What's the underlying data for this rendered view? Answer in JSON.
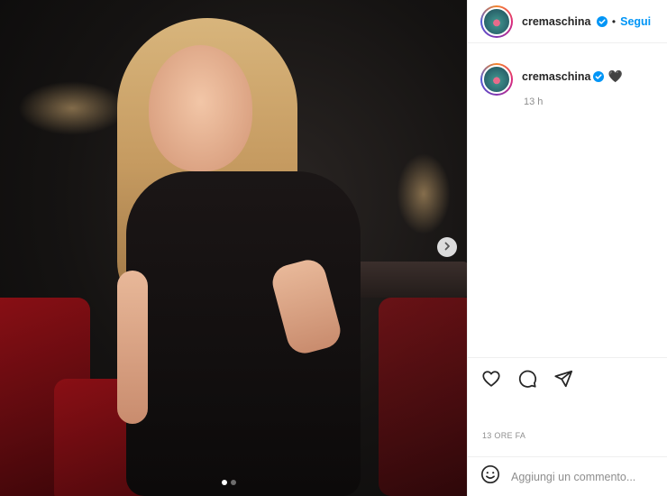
{
  "post": {
    "username": "cremaschina",
    "follow_label": "Segui",
    "separator": "•",
    "caption_text": "",
    "caption_emoji": "🖤",
    "relative_time": "13 h",
    "date_label": "13 ORE FA",
    "carousel": {
      "slides": 2,
      "active_index": 0
    }
  },
  "comment": {
    "placeholder": "Aggiungi un commento..."
  },
  "icons": {
    "verified": "verified-badge-icon",
    "next": "chevron-right-icon",
    "like": "heart-icon",
    "comment": "comment-bubble-icon",
    "share": "paper-plane-icon",
    "emoji": "smiley-icon"
  },
  "colors": {
    "accent": "#0095f6",
    "muted": "#8e8e8e",
    "text": "#262626",
    "divider": "#efefef"
  }
}
